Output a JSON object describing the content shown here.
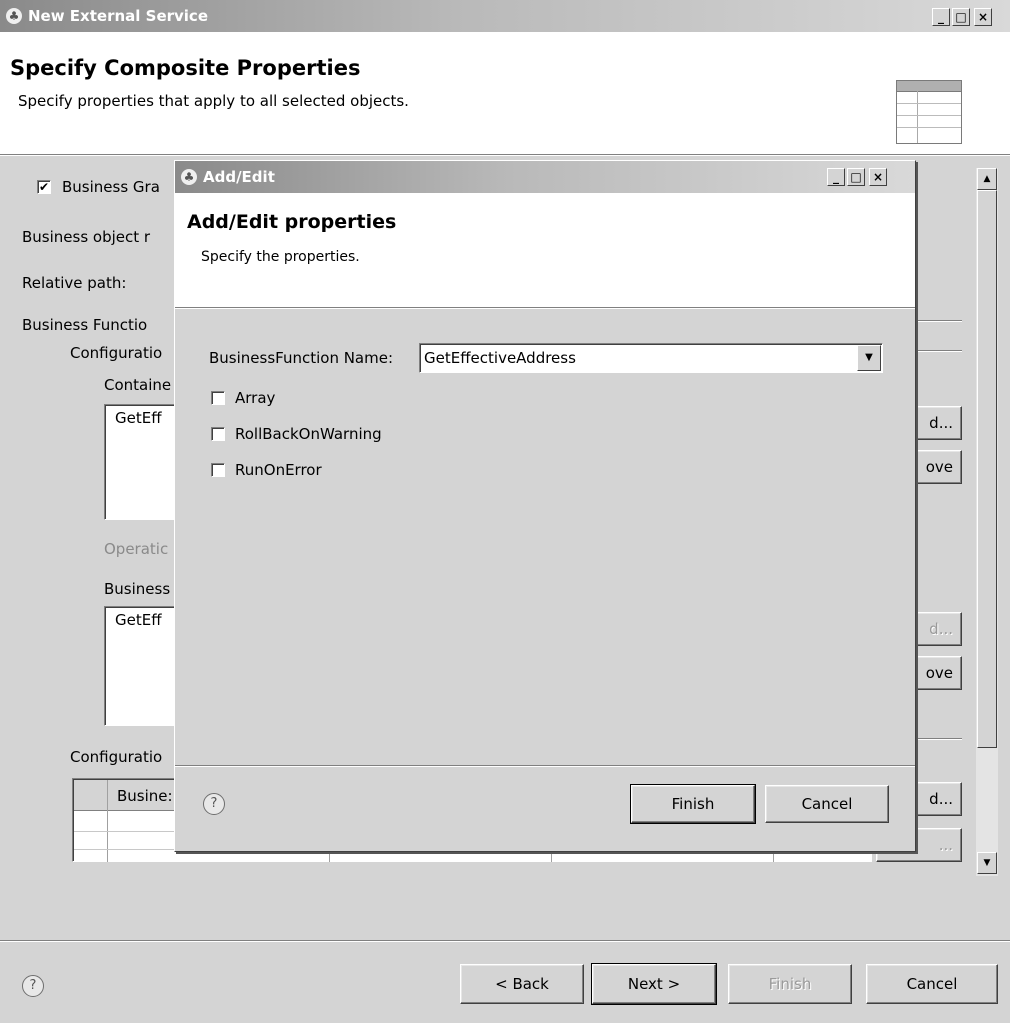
{
  "main_window": {
    "title": "New External Service",
    "heading": "Specify Composite Properties",
    "description": "Specify properties that apply to all selected objects.",
    "controls": {
      "minimize": "_",
      "maximize": "□",
      "close": "×"
    }
  },
  "background_form": {
    "business_graph_label": "Business Gra",
    "business_graph_checked": true,
    "business_object_label": "Business object r",
    "relative_path_label": "Relative path:",
    "business_function_label": "Business Functio",
    "configuration_label": "Configuratio",
    "container_label": "Containe",
    "container_list_item": "GetEff",
    "operation_label": "Operatic",
    "business_label": "Business",
    "business_list_item": "GetEff",
    "configuration2_label": "Configuratio",
    "table_header": "Busine:",
    "right_buttons": [
      "d...",
      "ove",
      "d...",
      "ove",
      "d...",
      "..."
    ]
  },
  "dialog": {
    "title": "Add/Edit",
    "heading": "Add/Edit properties",
    "description": "Specify the properties.",
    "business_function_name_label": "BusinessFunction Name:",
    "business_function_name_value": "GetEffectiveAddress",
    "checkboxes": [
      {
        "label": "Array",
        "checked": false
      },
      {
        "label": "RollBackOnWarning",
        "checked": false
      },
      {
        "label": "RunOnError",
        "checked": false
      }
    ],
    "finish_label": "Finish",
    "cancel_label": "Cancel",
    "help_icon": "?",
    "controls": {
      "minimize": "_",
      "maximize": "□",
      "close": "×"
    }
  },
  "footer": {
    "help_icon": "?",
    "back_label": "< Back",
    "next_label": "Next >",
    "finish_label": "Finish",
    "cancel_label": "Cancel"
  }
}
